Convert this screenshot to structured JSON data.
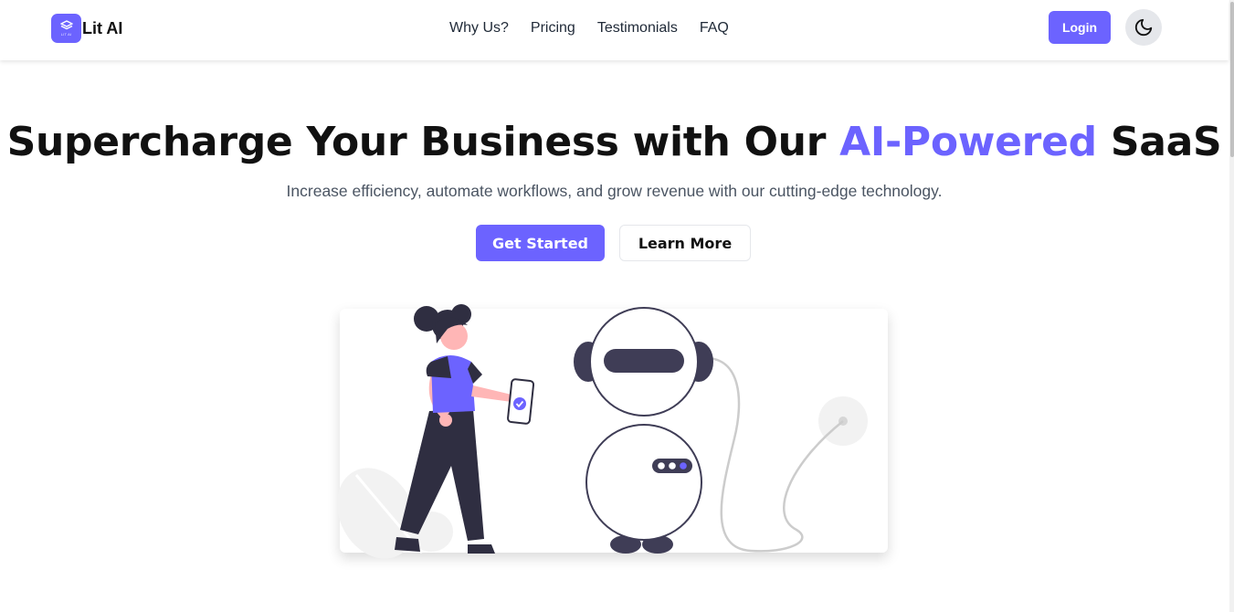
{
  "brand": {
    "name": "Lit AI",
    "logo_subtext": "LIT AI"
  },
  "nav": {
    "links": [
      "Why Us?",
      "Pricing",
      "Testimonials",
      "FAQ"
    ],
    "login_label": "Login",
    "theme_toggle_icon": "moon-icon"
  },
  "hero": {
    "title_before": "Supercharge Your Business with Our ",
    "title_accent": "AI-Powered",
    "title_after": " SaaS",
    "subtitle": "Increase efficiency, automate workflows, and grow revenue with our cutting-edge technology.",
    "primary_cta": "Get Started",
    "secondary_cta": "Learn More"
  },
  "colors": {
    "accent": "#6c63ff",
    "dark": "#2f2e41",
    "skin": "#ffb6b6",
    "light_gray": "#f2f2f2"
  }
}
